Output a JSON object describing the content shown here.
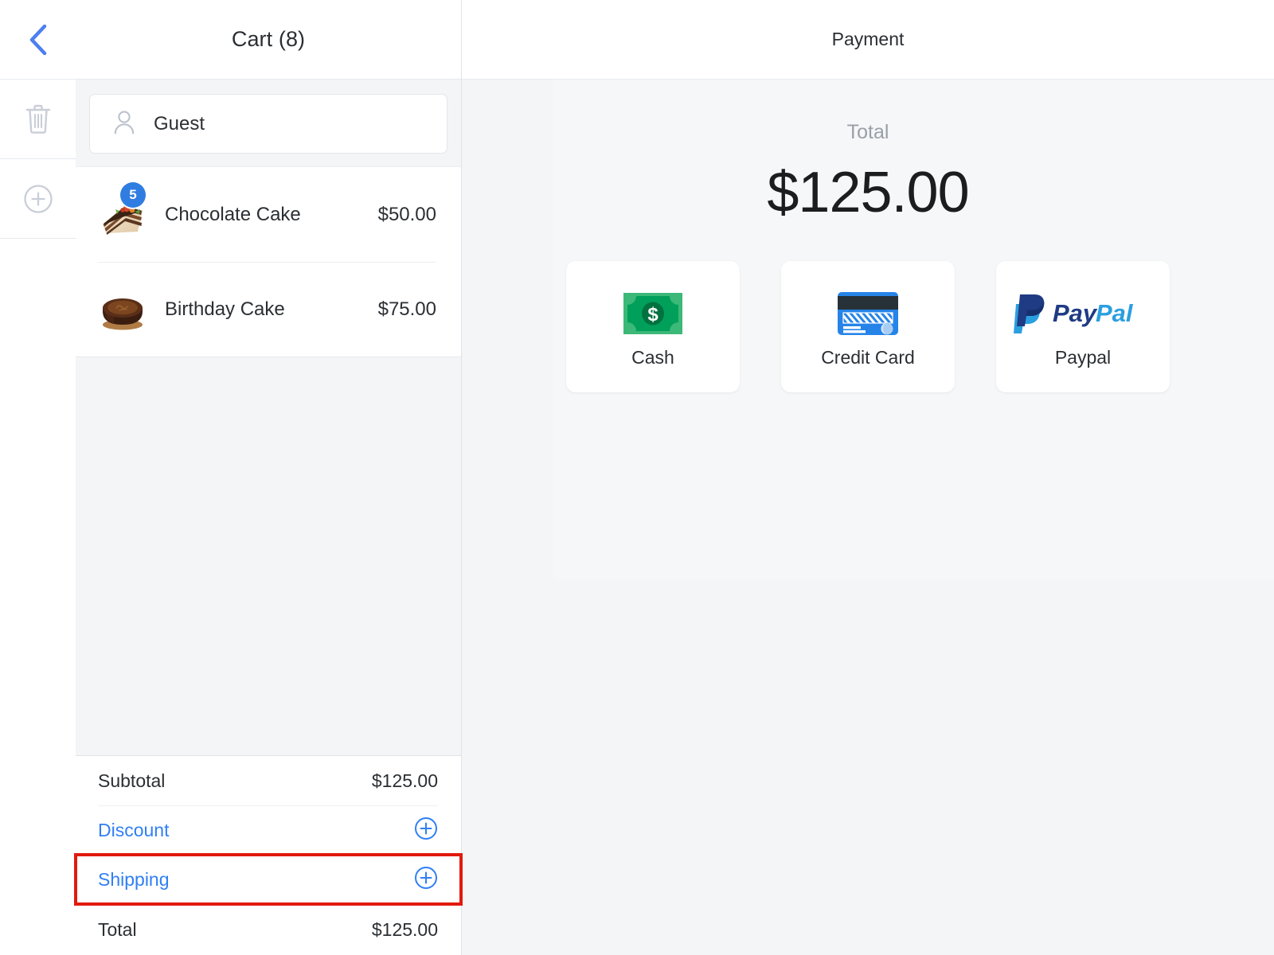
{
  "colors": {
    "accent_blue": "#307ff4",
    "badge_blue": "#2f7de1",
    "back_chevron_blue": "#4c7ff0",
    "highlight_red": "#e11a0d",
    "page_background": "#f4f5f7",
    "panel_white": "#ffffff",
    "muted_text": "#9aa0a6",
    "cash_green": "#2bab63",
    "card_blue": "#2684e8",
    "paypal_dark": "#1f3b84",
    "paypal_light": "#2a9fe0"
  },
  "rail": {
    "items": [
      {
        "name": "back-button",
        "icon": "chevron-left-icon"
      },
      {
        "name": "delete-cart-button",
        "icon": "trash-icon"
      },
      {
        "name": "add-cart-button",
        "icon": "plus-circle-icon"
      }
    ]
  },
  "cart": {
    "header_title": "Cart (8)",
    "customer": {
      "name": "Guest",
      "icon": "person-icon"
    },
    "items": [
      {
        "name": "Chocolate Cake",
        "price": "$50.00",
        "quantity": "5",
        "thumbnail": "chocolate-cake-slice-image"
      },
      {
        "name": "Birthday Cake",
        "price": "$75.00",
        "quantity": "",
        "thumbnail": "birthday-cake-image"
      }
    ],
    "summary": [
      {
        "label": "Subtotal",
        "value": "$125.00",
        "type": "value",
        "highlighted": false
      },
      {
        "label": "Discount",
        "value": "",
        "type": "add",
        "highlighted": false
      },
      {
        "label": "Shipping",
        "value": "",
        "type": "add",
        "highlighted": true
      },
      {
        "label": "Total",
        "value": "$125.00",
        "type": "value",
        "highlighted": false
      }
    ]
  },
  "payment": {
    "header_title": "Payment",
    "total_label": "Total",
    "total_amount": "$125.00",
    "methods": [
      {
        "label": "Cash",
        "icon": "banknote-icon"
      },
      {
        "label": "Credit Card",
        "icon": "credit-card-icon"
      },
      {
        "label": "Paypal",
        "icon": "paypal-logo-icon"
      }
    ]
  }
}
